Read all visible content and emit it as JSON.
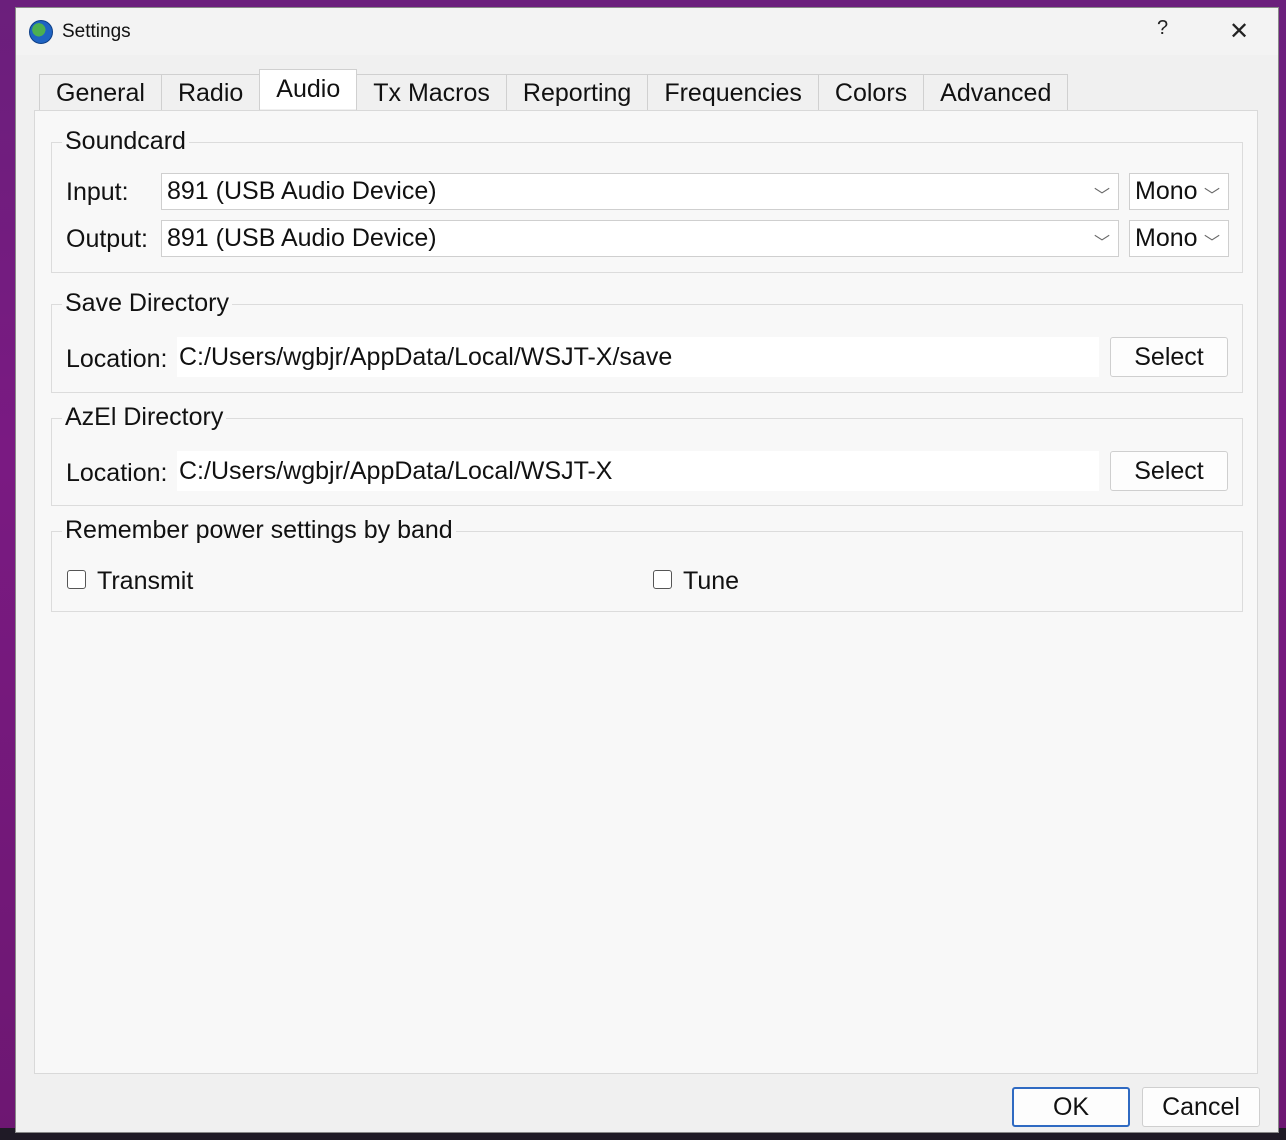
{
  "window": {
    "title": "Settings",
    "help": "?",
    "close": "✕"
  },
  "tabs": [
    "General",
    "Radio",
    "Audio",
    "Tx Macros",
    "Reporting",
    "Frequencies",
    "Colors",
    "Advanced"
  ],
  "active_tab": "Audio",
  "soundcard": {
    "title": "Soundcard",
    "input_label": "Input:",
    "input_device": "891 (USB Audio Device)",
    "input_channel": "Mono",
    "output_label": "Output:",
    "output_device": "891 (USB Audio Device)",
    "output_channel": "Mono"
  },
  "save_directory": {
    "title": "Save Directory",
    "location_label": "Location:",
    "location_value": "C:/Users/wgbjr/AppData/Local/WSJT-X/save",
    "select_label": "Select"
  },
  "azel_directory": {
    "title": "AzEl Directory",
    "location_label": "Location:",
    "location_value": "C:/Users/wgbjr/AppData/Local/WSJT-X",
    "select_label": "Select"
  },
  "power": {
    "title": "Remember power settings by band",
    "transmit_label": "Transmit",
    "tune_label": "Tune"
  },
  "footer": {
    "ok_label": "OK",
    "cancel_label": "Cancel"
  }
}
